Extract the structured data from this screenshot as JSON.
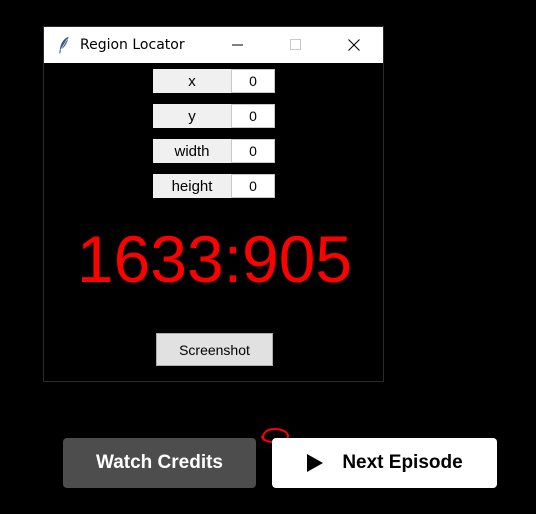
{
  "window": {
    "title": "Region Locator",
    "icon": "feather-icon",
    "controls": {
      "minimize_icon": "minimize-icon",
      "maximize_icon": "maximize-icon",
      "close_icon": "close-icon"
    }
  },
  "fields": {
    "x": {
      "label": "x",
      "value": "0"
    },
    "y": {
      "label": "y",
      "value": "0"
    },
    "width": {
      "label": "width",
      "value": "0"
    },
    "height": {
      "label": "height",
      "value": "0"
    }
  },
  "readout": {
    "text": "1633:905",
    "color": "#ff0000"
  },
  "screenshot_button": {
    "label": "Screenshot"
  },
  "player": {
    "watch_credits_label": "Watch Credits",
    "next_episode_label": "Next Episode",
    "play_icon": "play-icon",
    "annotation_color": "#ff0000"
  },
  "colors": {
    "background": "#000000",
    "titlebar": "#ffffff",
    "watch_credits_bg": "#4d4d4d",
    "next_episode_bg": "#ffffff"
  }
}
